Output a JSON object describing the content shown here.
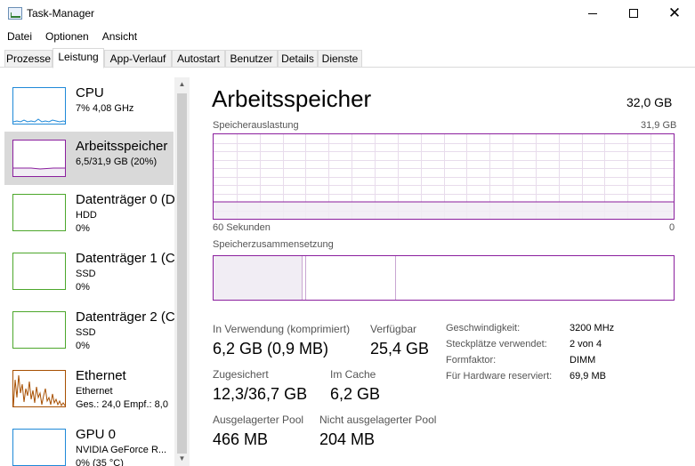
{
  "window": {
    "title": "Task-Manager",
    "minimize_icon": "minimize-icon",
    "maximize_icon": "maximize-icon",
    "close_icon": "close-icon",
    "close_glyph": "✕"
  },
  "menu": [
    "Datei",
    "Optionen",
    "Ansicht"
  ],
  "tabs": [
    "Prozesse",
    "Leistung",
    "App-Verlauf",
    "Autostart",
    "Benutzer",
    "Details",
    "Dienste"
  ],
  "active_tab": "Leistung",
  "sidebar": {
    "items": [
      {
        "name": "CPU",
        "line1": "7% 4,08 GHz",
        "line2": "",
        "color": "#1f89d8",
        "icon": "cpu-graph-icon"
      },
      {
        "name": "Arbeitsspeicher",
        "line1": "6,5/31,9 GB (20%)",
        "line2": "",
        "color": "#8b1f9e",
        "icon": "memory-graph-icon"
      },
      {
        "name": "Datenträger 0 (D",
        "line1": "HDD",
        "line2": "0%",
        "color": "#4ca72b",
        "icon": "disk-graph-icon"
      },
      {
        "name": "Datenträger 1 (C",
        "line1": "SSD",
        "line2": "0%",
        "color": "#4ca72b",
        "icon": "disk-graph-icon"
      },
      {
        "name": "Datenträger 2 (C",
        "line1": "SSD",
        "line2": "0%",
        "color": "#4ca72b",
        "icon": "disk-graph-icon"
      },
      {
        "name": "Ethernet",
        "line1": "Ethernet",
        "line2": "Ges.: 24,0  Empf.: 8,0",
        "color": "#a74f01",
        "icon": "ethernet-graph-icon"
      },
      {
        "name": "GPU 0",
        "line1": "NVIDIA GeForce R...",
        "line2": "0% (35 °C)",
        "color": "#1f89d8",
        "icon": "gpu-graph-icon"
      }
    ],
    "scroll_up_glyph": "▲",
    "scroll_down_glyph": "▼"
  },
  "main": {
    "title": "Arbeitsspeicher",
    "total": "32,0 GB",
    "usage_label": "Speicherauslastung",
    "usage_max": "31,9 GB",
    "time_label": "60 Sekunden",
    "time_end": "0",
    "usage_fraction": 0.2,
    "composition_label": "Speicherzusammensetzung",
    "composition": {
      "in_use_gb": 6.2,
      "modified_gb": 0.1,
      "standby_gb": 6.2,
      "free_gb": 19.4,
      "total_gb": 31.9
    },
    "stats": [
      {
        "label": "In Verwendung (komprimiert)",
        "value": "6,2 GB (0,9 MB)"
      },
      {
        "label": "Verfügbar",
        "value": "25,4 GB"
      },
      {
        "label": "Zugesichert",
        "value": "12,3/36,7 GB"
      },
      {
        "label": "Im Cache",
        "value": "6,2 GB"
      },
      {
        "label": "Ausgelagerter Pool",
        "value": "466 MB"
      },
      {
        "label": "Nicht ausgelagerter Pool",
        "value": "204 MB"
      }
    ],
    "specs": [
      {
        "label": "Geschwindigkeit:",
        "value": "3200 MHz"
      },
      {
        "label": "Steckplätze verwendet:",
        "value": "2 von 4"
      },
      {
        "label": "Formfaktor:",
        "value": "DIMM"
      },
      {
        "label": "Für Hardware reserviert:",
        "value": "69,9 MB"
      }
    ]
  },
  "colors": {
    "memory": "#8b1f9e",
    "memory_fill": "#f1edf4",
    "grid": "#e8dcec"
  }
}
